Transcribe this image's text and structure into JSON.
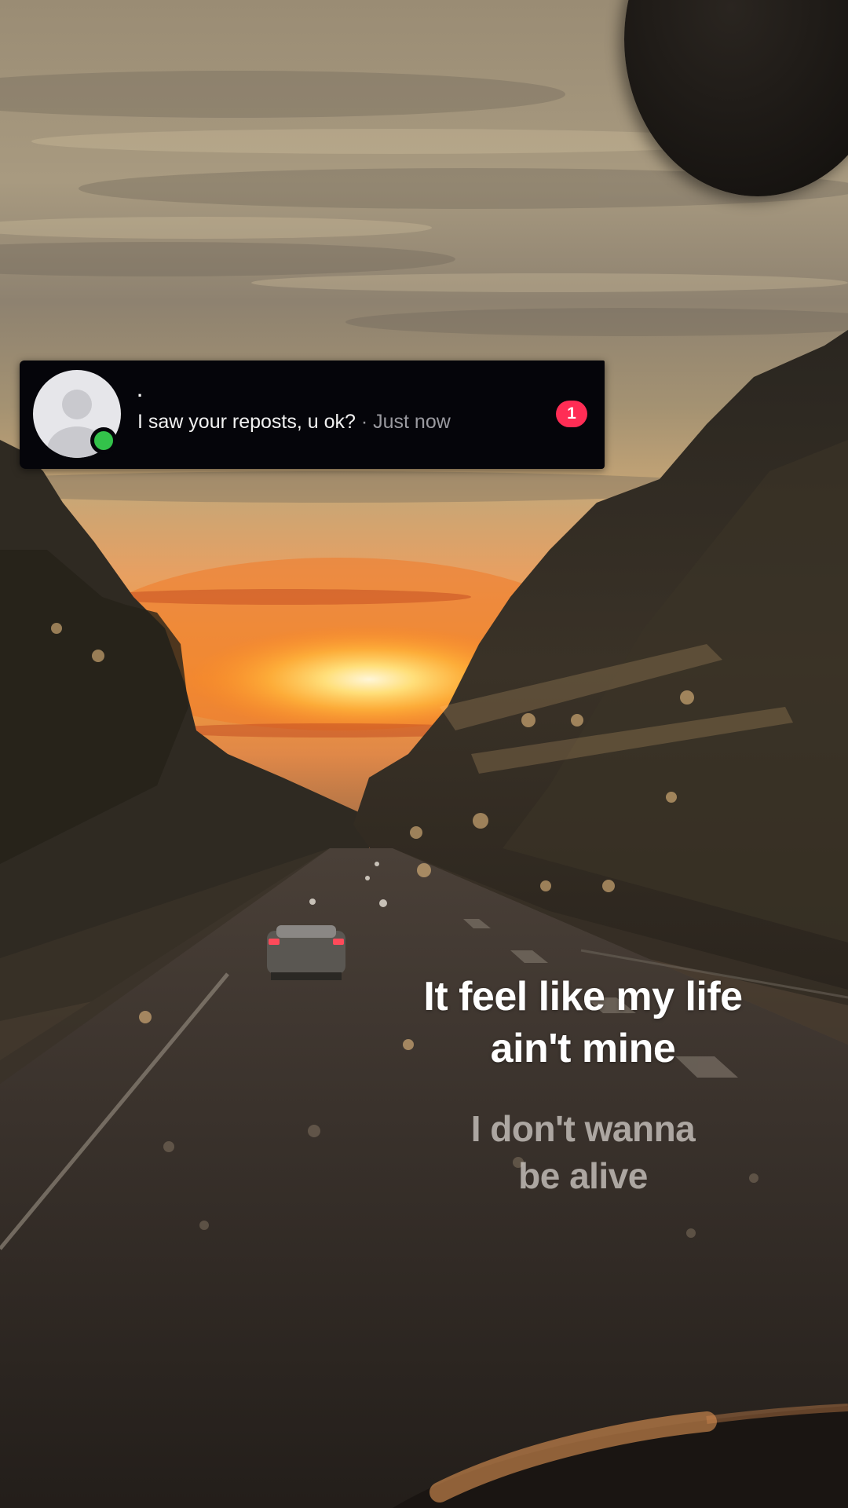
{
  "notification": {
    "sender": ".",
    "message": "I saw your reposts, u ok?",
    "separator": " · ",
    "time": "Just now",
    "badge_count": "1",
    "avatar_icon": "default-profile-avatar-icon",
    "status_icon": "online-status-dot-icon",
    "online_color": "#33c24a",
    "badge_color": "#ff2d55"
  },
  "lyrics": {
    "current_line_1": "It feel like my life",
    "current_line_2": "ain't mine",
    "next_line_1": "I don't wanna",
    "next_line_2": "be alive"
  }
}
